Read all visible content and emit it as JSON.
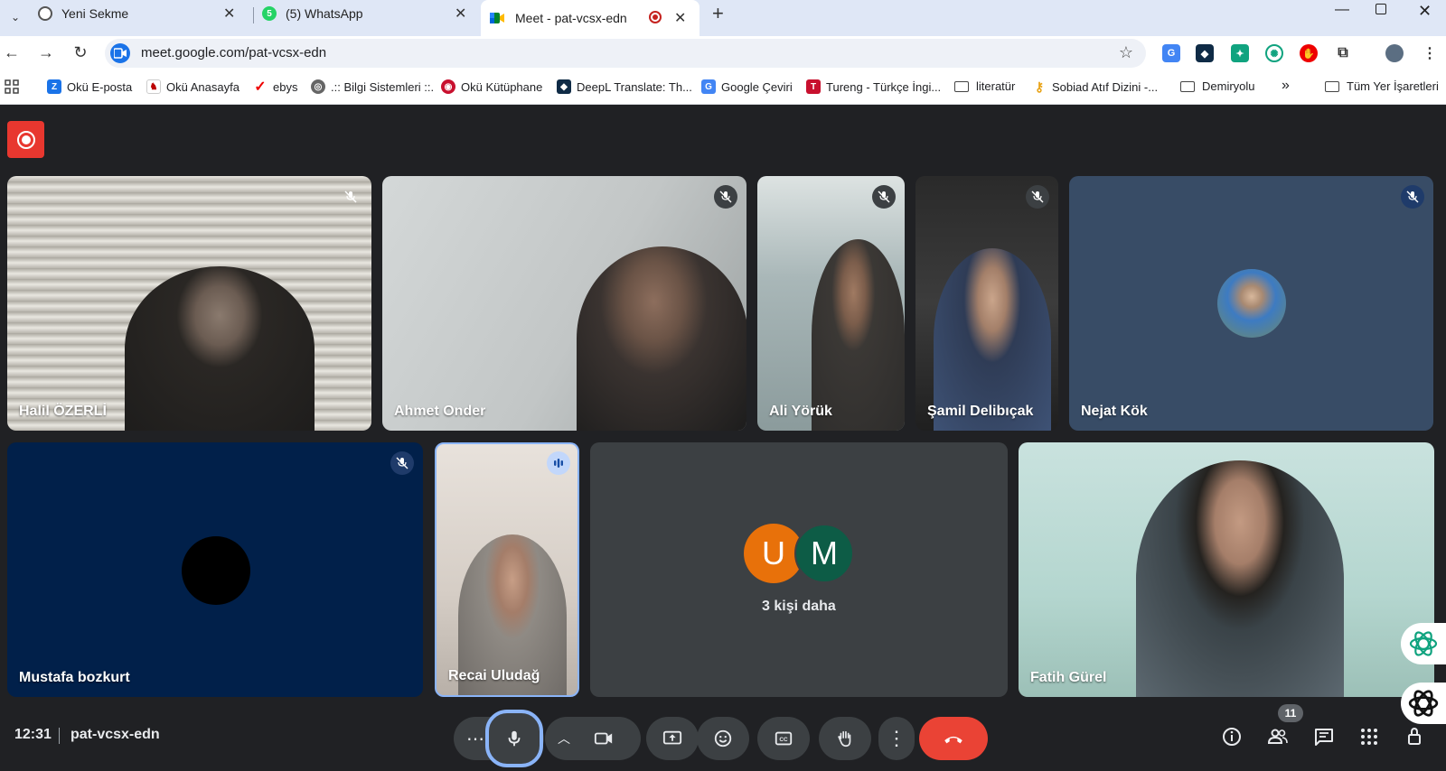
{
  "browser": {
    "tabs": [
      {
        "title": "Yeni Sekme"
      },
      {
        "title": "(5) WhatsApp",
        "badge": "5"
      },
      {
        "title": "Meet - pat-vcsx-edn"
      }
    ],
    "url": "meet.google.com/pat-vcsx-edn",
    "bookmarks": [
      "Okü E-posta",
      "Okü Anasayfa",
      "ebys",
      ".:: Bilgi Sistemleri ::.",
      "Okü Kütüphane",
      "DeepL Translate: Th...",
      "Google Çeviri",
      "Tureng - Türkçe İngi...",
      "literatür",
      "Sobiad Atıf Dizini -...",
      "Demiryolu",
      "Tüm Yer İşaretleri"
    ],
    "bookmark_overflow": "»"
  },
  "meet": {
    "participants": [
      {
        "name": "Halil ÖZERLİ",
        "muted": true
      },
      {
        "name": "Ahmet Onder",
        "muted": true
      },
      {
        "name": "Ali Yörük",
        "muted": true
      },
      {
        "name": "Şamil Delibıçak",
        "muted": true
      },
      {
        "name": "Nejat Kök",
        "muted": true
      },
      {
        "name": "Mustafa bozkurt",
        "muted": true
      },
      {
        "name": "Recai Uludağ",
        "speaking": true
      },
      {
        "name": "Fatih Gürel",
        "muted": false
      }
    ],
    "others": {
      "label": "3 kişi daha",
      "initials": [
        "U",
        "M"
      ]
    },
    "time": "12:31",
    "meeting_code": "pat-vcsx-edn",
    "participant_count": "11"
  },
  "colors": {
    "record": "#e8372f",
    "leave": "#ea4335",
    "avatar_u": "#e8710a",
    "avatar_m": "#0d5c46",
    "mic_ring": "#8ab4f8"
  }
}
